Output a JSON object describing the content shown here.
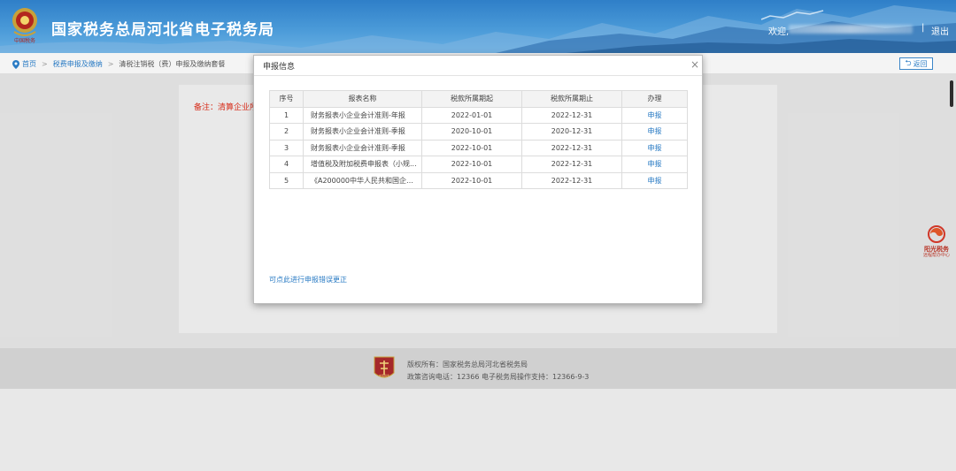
{
  "header": {
    "title": "国家税务总局河北省电子税务局",
    "welcome": "欢迎,",
    "separator": "|",
    "logout": "退出",
    "emblem_text": "中国税务"
  },
  "breadcrumb": {
    "home": "首页",
    "item1": "税费申报及缴纳",
    "item2": "清税注销税（费）申报及缴纳套餐",
    "back_label": "返回"
  },
  "content": {
    "note": "备注：清算企业所"
  },
  "modal": {
    "title": "申报信息",
    "close": "×",
    "columns": [
      "序号",
      "报表名称",
      "税款所属期起",
      "税款所属期止",
      "办理"
    ],
    "rows": [
      {
        "no": "1",
        "name": "财务报表小企业会计准则-年报",
        "start": "2022-01-01",
        "end": "2022-12-31",
        "action": "申报"
      },
      {
        "no": "2",
        "name": "财务报表小企业会计准则-季报",
        "start": "2020-10-01",
        "end": "2020-12-31",
        "action": "申报"
      },
      {
        "no": "3",
        "name": "财务报表小企业会计准则-季报",
        "start": "2022-10-01",
        "end": "2022-12-31",
        "action": "申报"
      },
      {
        "no": "4",
        "name": "增值税及附加税费申报表（小规...",
        "start": "2022-10-01",
        "end": "2022-12-31",
        "action": "申报"
      },
      {
        "no": "5",
        "name": "《A200000中华人民共和国企业...",
        "start": "2022-10-01",
        "end": "2022-12-31",
        "action": "申报"
      }
    ],
    "correct_link": "可点此进行申报错误更正"
  },
  "side_widget": {
    "title": "阳光税务",
    "subtitle": "远程帮办中心"
  },
  "footer": {
    "copyright": "版权所有：国家税务总局河北省税务局",
    "contact": "政策咨询电话：12366    电子税务局操作支持：12366-9-3",
    "logo_text": "中国税务"
  },
  "colors": {
    "header_blue": "#2f7fc8",
    "link_blue": "#2a7bc4",
    "note_red": "#e0301e"
  }
}
